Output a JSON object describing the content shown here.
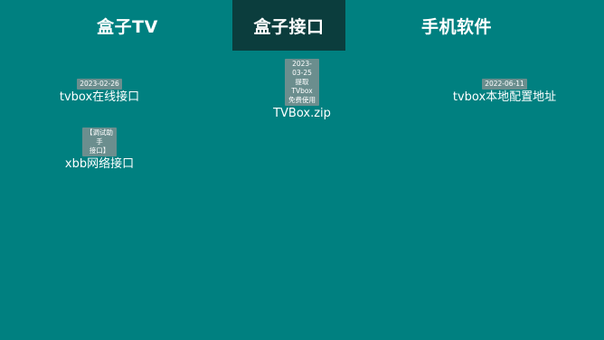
{
  "tabs": [
    {
      "label": "盒子TV"
    },
    {
      "label": "盒子接口",
      "selected": true
    },
    {
      "label": "手机软件"
    }
  ],
  "items": [
    {
      "badge": "2023-02-26",
      "label": "tvbox在线接口"
    },
    {
      "badge": "2023-03-25\n提取TVbox\n免费使用",
      "label": "TVBox.zip"
    },
    {
      "badge": "2022-06-11",
      "label": "tvbox本地配置地址"
    },
    {
      "badge": "【调试助手\n接口】",
      "label": "xbb网络接口"
    }
  ],
  "colors": {
    "background": "#008080",
    "selected_tab": "#0b3d3d",
    "badge": "#6b8e8e",
    "text": "#ffffff"
  }
}
